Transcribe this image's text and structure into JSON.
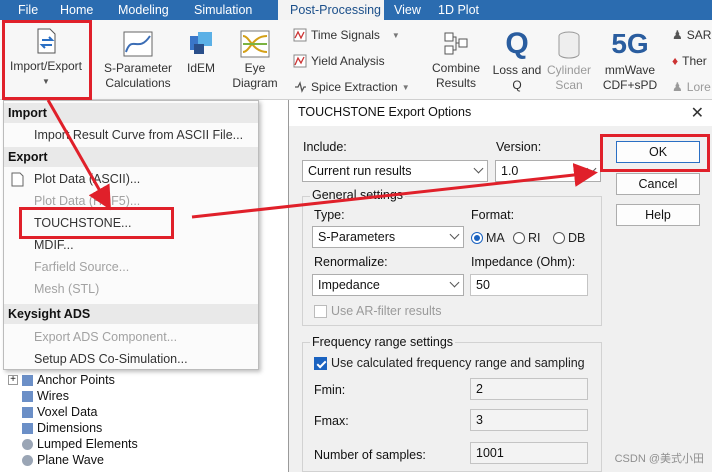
{
  "ribbon_tabs": [
    "File",
    "Home",
    "Modeling",
    "Simulation",
    "Post-Processing",
    "View",
    "1D Plot"
  ],
  "ribbon": {
    "import_export": "Import/Export",
    "sparam_line1": "S-Parameter",
    "sparam_line2": "Calculations",
    "idem": "IdEM",
    "eye_line1": "Eye",
    "eye_line2": "Diagram",
    "time_signals": "Time Signals",
    "yield_analysis": "Yield Analysis",
    "spice_extraction": "Spice Extraction",
    "combine_line1": "Combine",
    "combine_line2": "Results",
    "loss_line1": "Loss and",
    "loss_line2": "Q",
    "cyl_line1": "Cylinder",
    "cyl_line2": "Scan",
    "mmw_line1": "mmWave",
    "mmw_line2": "CDF+sPD",
    "sar": "SAR",
    "ther": "Ther",
    "lore": "Lore"
  },
  "menu": {
    "import_header": "Import",
    "import_ascii": "Import Result Curve from ASCII File...",
    "export_header": "Export",
    "plot_ascii": "Plot Data (ASCII)...",
    "plot_hdf5": "Plot Data (HDF5)...",
    "touchstone": "TOUCHSTONE...",
    "mdif": "MDIF...",
    "farfield": "Farfield Source...",
    "mesh": "Mesh (STL)",
    "ads_header": "Keysight ADS",
    "export_ads": "Export ADS Component...",
    "setup_ads": "Setup ADS Co-Simulation..."
  },
  "tree": [
    "Anchor Points",
    "Wires",
    "Voxel Data",
    "Dimensions",
    "Lumped Elements",
    "Plane Wave"
  ],
  "dialog": {
    "title": "TOUCHSTONE Export Options",
    "close": "✕",
    "include_label": "Include:",
    "include_value": "Current run results",
    "version_label": "Version:",
    "version_value": "1.0",
    "ok": "OK",
    "cancel": "Cancel",
    "help": "Help",
    "general_title": "General settings",
    "type_label": "Type:",
    "type_value": "S-Parameters",
    "format_label": "Format:",
    "format_ma": "MA",
    "format_ri": "RI",
    "format_db": "DB",
    "renorm_label": "Renormalize:",
    "renorm_value": "Impedance",
    "impedance_label": "Impedance (Ohm):",
    "impedance_value": "50",
    "ar_filter": "Use AR-filter results",
    "freq_title": "Frequency range settings",
    "use_calc": "Use calculated frequency range and sampling",
    "fmin_label": "Fmin:",
    "fmin_value": "2",
    "fmax_label": "Fmax:",
    "fmax_value": "3",
    "samples_label": "Number of samples:",
    "samples_value": "1001"
  },
  "watermark": "CSDN @美式小田",
  "colors": {
    "ribbon_blue": "#2b6cb0",
    "highlight_red": "#e0202a",
    "check_blue": "#1a62c0"
  }
}
